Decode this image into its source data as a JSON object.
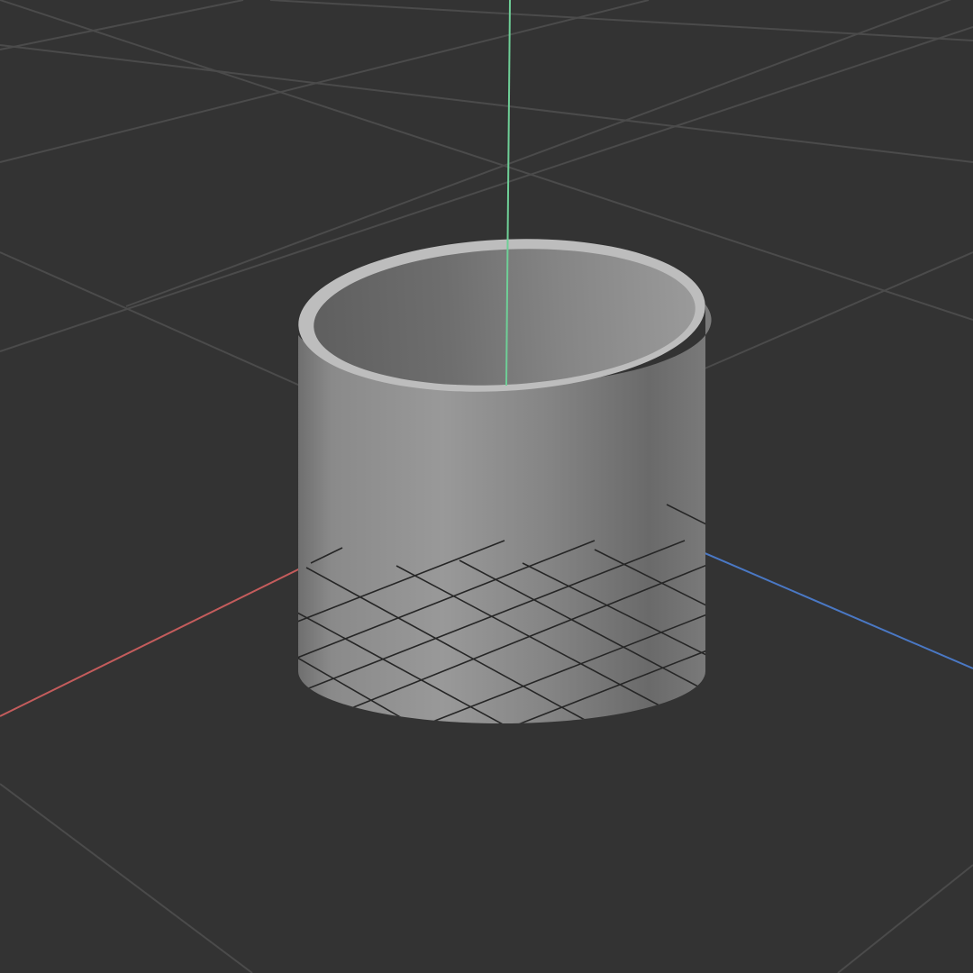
{
  "viewport": {
    "background_color": "#333333",
    "grid_color": "#4b4b4b",
    "axis_colors": {
      "x": "#c45c5c",
      "y": "#6fcf97",
      "z": "#4a78c4"
    },
    "object": {
      "name": "hollow-cylinder",
      "body_color": "#8f8f8f",
      "rim_color": "#bdbdbd",
      "inner_color": "#7a7a7a"
    }
  }
}
